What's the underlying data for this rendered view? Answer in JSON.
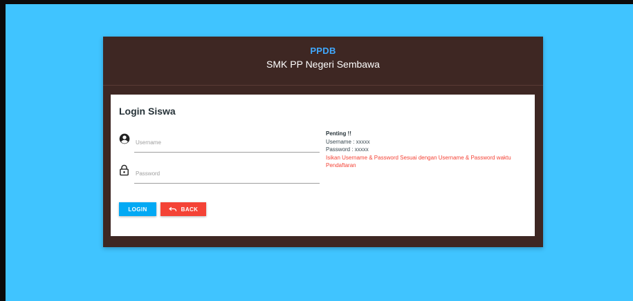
{
  "header": {
    "brand_short": "PPDB",
    "brand_long": "SMK PP Negeri Sembawa"
  },
  "login": {
    "title": "Login Siswa",
    "username": {
      "placeholder": "Username",
      "value": "",
      "icon": "account-circle-icon"
    },
    "password": {
      "placeholder": "Password",
      "value": "",
      "icon": "lock-icon"
    },
    "buttons": {
      "login_label": "LOGIN",
      "back_label": "BACK",
      "back_icon": "undo-icon"
    }
  },
  "info": {
    "title": "Penting !!",
    "username_line": "Username : xxxxx",
    "password_line": "Password : xxxxx",
    "warning": "Isikan Username & Password Sesuai dengan Username & Password waktu Pendaftaran"
  },
  "colors": {
    "background": "#40c4ff",
    "card": "#3e2723",
    "brand_accent": "#40a9ff",
    "login_button": "#03a9f4",
    "back_button": "#f44336",
    "warning_text": "#f44336"
  }
}
